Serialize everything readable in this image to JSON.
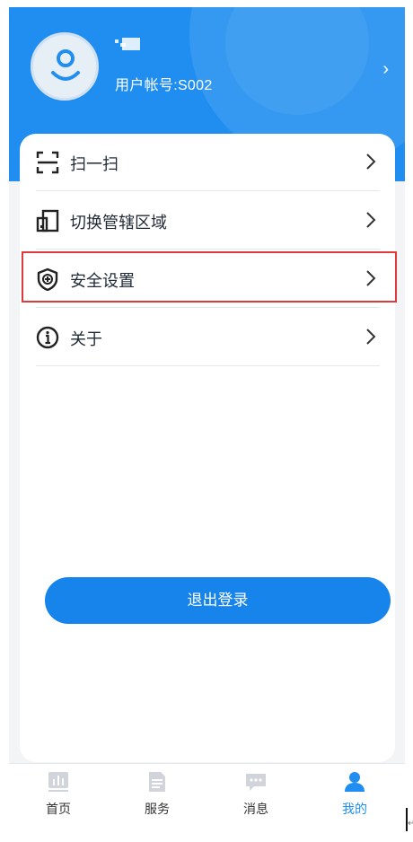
{
  "profile": {
    "user_id_text": "用户帐号:S002",
    "chevron": "›"
  },
  "menu": {
    "items": [
      {
        "label": "扫一扫",
        "icon": "scan-icon"
      },
      {
        "label": "切换管辖区域",
        "icon": "switch-area-icon"
      },
      {
        "label": "安全设置",
        "icon": "shield-plus-icon"
      },
      {
        "label": "关于",
        "icon": "info-icon"
      }
    ],
    "highlighted_item": "安全设置"
  },
  "logout": {
    "label": "退出登录"
  },
  "tabbar": {
    "tabs": [
      {
        "label": "首页",
        "icon": "chart-icon"
      },
      {
        "label": "服务",
        "icon": "document-icon"
      },
      {
        "label": "消息",
        "icon": "message-icon"
      },
      {
        "label": "我的",
        "icon": "user-icon",
        "active": true
      }
    ]
  },
  "colors": {
    "primary": "#1f8ef0",
    "highlight_border": "#e0393b",
    "inactive_icon": "#d1d5db",
    "text": "#1f2937"
  }
}
